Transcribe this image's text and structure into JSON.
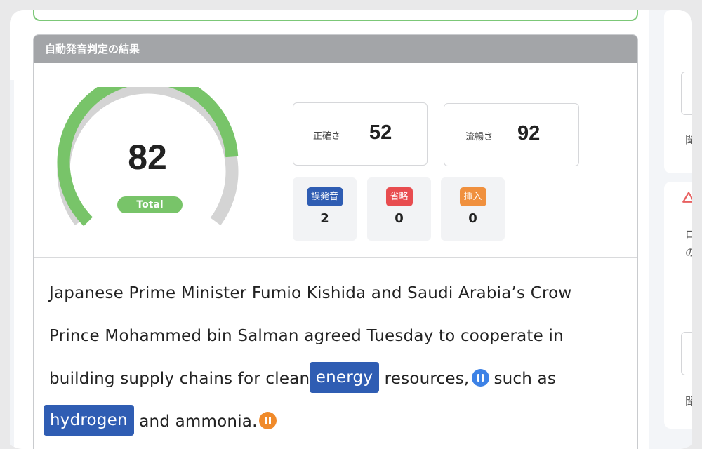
{
  "panel": {
    "title": "自動発音判定の結果"
  },
  "scores": {
    "total": {
      "value": "82",
      "label": "Total",
      "fraction": 0.82
    },
    "accuracy": {
      "label": "正確さ",
      "value": "52"
    },
    "fluency": {
      "label": "流暢さ",
      "value": "92"
    }
  },
  "errors": {
    "mispronunciation": {
      "label": "誤発音",
      "count": "2"
    },
    "omission": {
      "label": "省略",
      "count": "0"
    },
    "insertion": {
      "label": "挿入",
      "count": "0"
    }
  },
  "passage": {
    "line1": "Japanese Prime Minister Fumio Kishida and Saudi Arabia’s Crow",
    "line2": "Prince Mohammed bin Salman agreed Tuesday to cooperate in",
    "line3_pre": "building supply chains for clean ",
    "line3_hl": "energy",
    "line3_mid": "resources,",
    "line3_post": "such as",
    "line4_hl": "hydrogen",
    "line4_post": " and ammonia."
  },
  "side": {
    "char1": "聞",
    "char2": "ロ",
    "char3": "の",
    "char4": "聞"
  },
  "colors": {
    "gauge_fill": "#78c469",
    "gauge_track": "#d4d4d4",
    "highlight": "#2f5db3",
    "pause_blue": "#3d82e6",
    "pause_orange": "#f08a2a"
  }
}
